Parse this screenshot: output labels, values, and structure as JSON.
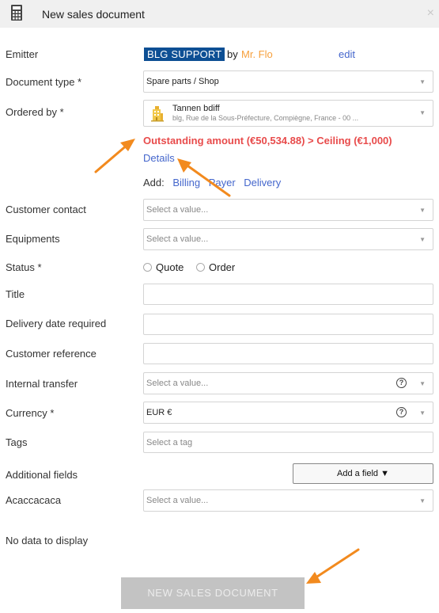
{
  "header": {
    "title": "New sales document",
    "close_glyph": "×",
    "icon": "calculator-icon"
  },
  "emitter": {
    "label": "Emitter",
    "badge": "BLG SUPPORT",
    "by": "by",
    "name": "Mr. Flo",
    "edit": "edit"
  },
  "document_type": {
    "label": "Document type *",
    "value": "Spare parts / Shop"
  },
  "ordered_by": {
    "label": "Ordered by *",
    "company": "Tannen bdiff",
    "address": "blg, Rue de la Sous-Préfecture, Compiègne, France - 00 ..."
  },
  "alert": {
    "text": "Outstanding amount (€50,534.88) > Ceiling (€1,000)",
    "details": "Details"
  },
  "add": {
    "label": "Add:",
    "billing": "Billing",
    "payer": "Payer",
    "delivery": "Delivery"
  },
  "customer_contact": {
    "label": "Customer contact",
    "placeholder": "Select a value..."
  },
  "equipments": {
    "label": "Equipments",
    "placeholder": "Select a value..."
  },
  "status": {
    "label": "Status *",
    "options": [
      "Quote",
      "Order"
    ]
  },
  "title_field": {
    "label": "Title"
  },
  "delivery_date": {
    "label": "Delivery date required"
  },
  "customer_reference": {
    "label": "Customer reference"
  },
  "internal_transfer": {
    "label": "Internal transfer",
    "placeholder": "Select a value...",
    "help": "?"
  },
  "currency": {
    "label": "Currency *",
    "value": "EUR €",
    "help": "?"
  },
  "tags": {
    "label": "Tags",
    "placeholder": "Select a tag"
  },
  "additional_fields": {
    "label": "Additional fields",
    "button": "Add a field ▼"
  },
  "acaccacaca": {
    "label": "Acaccacaca",
    "placeholder": "Select a value..."
  },
  "no_data": "No data to display",
  "submit": "NEW SALES DOCUMENT",
  "caret_glyph": "▼",
  "colors": {
    "badge": "#0d4f94",
    "alert": "#e84b4b",
    "link": "#4466cc",
    "name": "#f7a03c",
    "arrow": "#f28a1e",
    "submit": "#c3c3c3"
  }
}
